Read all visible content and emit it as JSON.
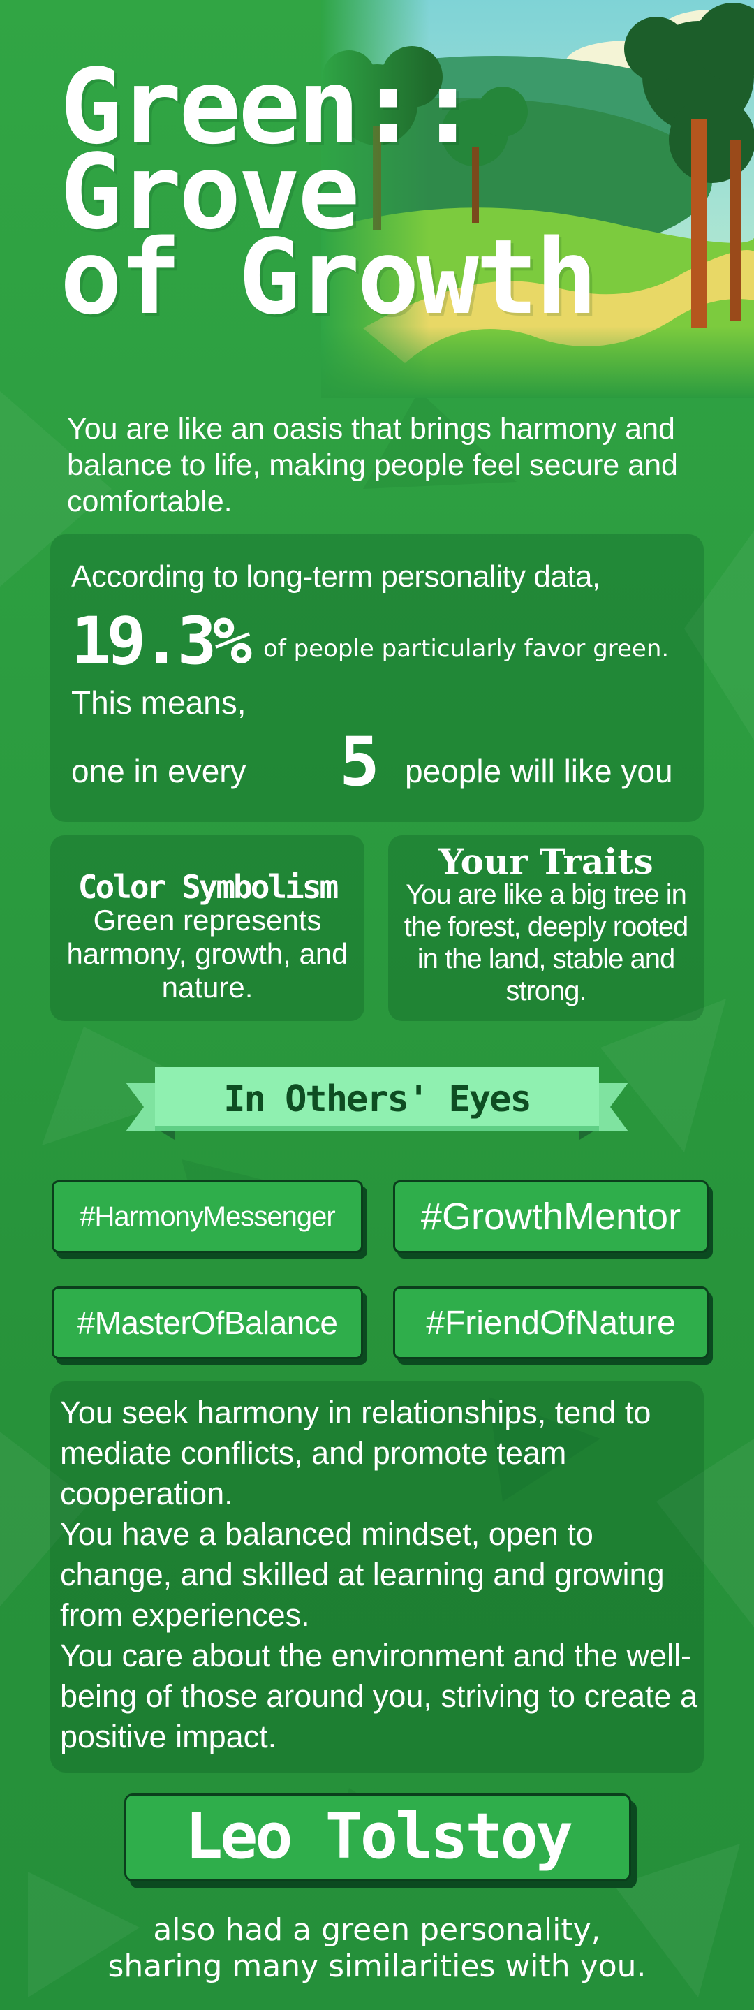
{
  "title": {
    "line1": "Green::",
    "line2": "Grove",
    "line3": "of Growth"
  },
  "intro": "You are like an oasis that brings harmony and balance to life, making people feel secure and comfortable.",
  "stats": {
    "line1": "According to long-term personality data,",
    "percent": "19.3%",
    "percent_text": "of people particularly favor green.",
    "line3": "This means,",
    "line4_prefix": "one in every",
    "number": "5",
    "line4_suffix": "people will like you"
  },
  "symbolism": {
    "title": "Color Symbolism",
    "body": "Green represents harmony, growth, and nature."
  },
  "traits": {
    "title": "Your Traits",
    "body": "You are like a big tree in the forest, deeply rooted in the land, stable and strong."
  },
  "others_eyes": {
    "label": "In Others' Eyes"
  },
  "tags": [
    "#HarmonyMessenger",
    "#GrowthMentor",
    "#MasterOfBalance",
    "#FriendOfNature"
  ],
  "description": {
    "p1": "You seek harmony in relationships, tend to mediate conflicts, and promote team  cooperation.",
    "p2": "You have a balanced mindset, open to change, and skilled at learning and growing from experiences.",
    "p3": "You care about the environment and the well-being of those around you, striving to create a positive impact."
  },
  "celebrity": {
    "name": "Leo Tolstoy",
    "caption_line1": "also had a green personality,",
    "caption_line2": "sharing many similarities with you."
  },
  "colors": {
    "background": "#2b9b3f",
    "card": "#1f7a33",
    "tag": "#2fae4b",
    "ribbon": "#8ff0b0",
    "ribbon_text": "#0e4d22"
  }
}
